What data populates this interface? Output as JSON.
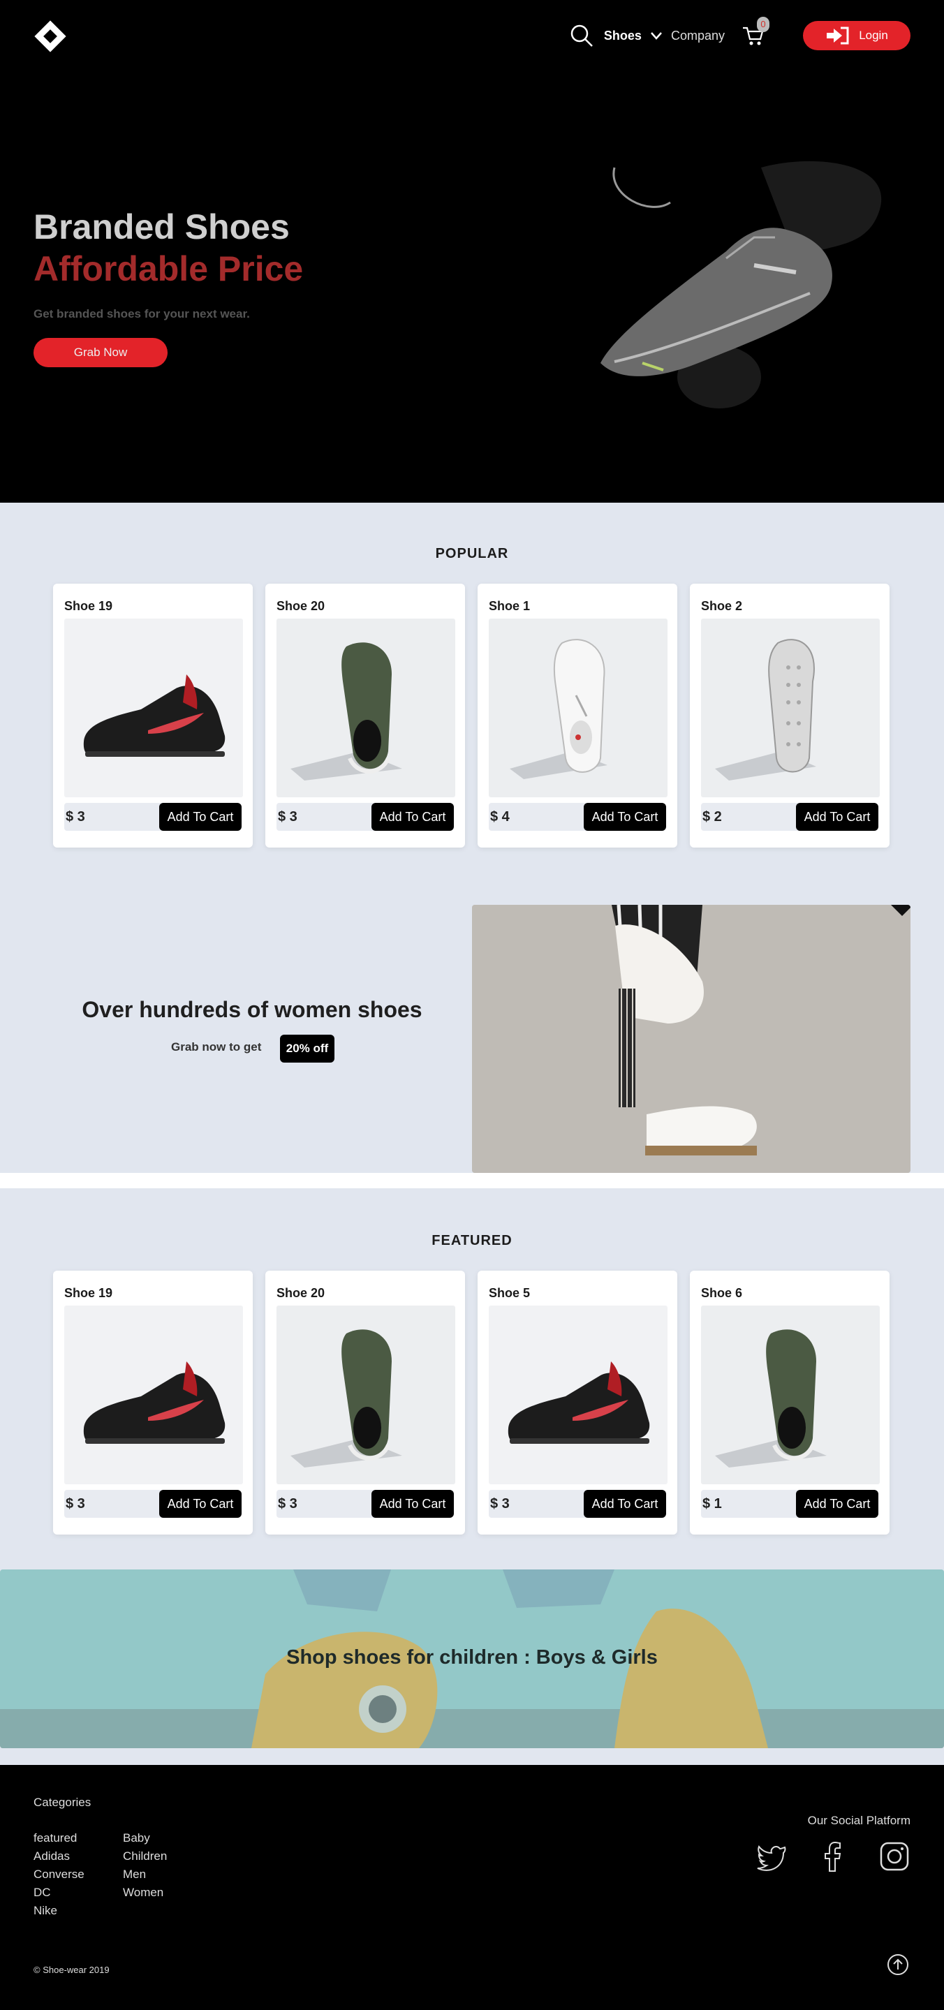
{
  "nav": {
    "logo_icon": "diamond-logo",
    "search_icon": "search-icon",
    "shoes_label": "Shoes",
    "company_label": "Company",
    "cart_count": "0",
    "login_label": "Login"
  },
  "hero": {
    "title_line1": "Branded Shoes",
    "title_line2": "Affordable Price",
    "subtitle": "Get branded shoes for your next wear.",
    "cta": "Grab Now"
  },
  "popular": {
    "title": "POPULAR",
    "items": [
      {
        "name": "Shoe 19",
        "price": "$ 3",
        "button": "Add To Cart"
      },
      {
        "name": "Shoe 20",
        "price": "$ 3",
        "button": "Add To Cart"
      },
      {
        "name": "Shoe 1",
        "price": "$ 4",
        "button": "Add To Cart"
      },
      {
        "name": "Shoe 2",
        "price": "$ 2",
        "button": "Add To Cart"
      }
    ]
  },
  "promo": {
    "title": "Over hundreds of women shoes",
    "subtitle": "Grab now to get",
    "badge": "20% off"
  },
  "featured": {
    "title": "FEATURED",
    "items": [
      {
        "name": "Shoe 19",
        "price": "$ 3",
        "button": "Add To Cart"
      },
      {
        "name": "Shoe 20",
        "price": "$ 3",
        "button": "Add To Cart"
      },
      {
        "name": "Shoe 5",
        "price": "$ 3",
        "button": "Add To Cart"
      },
      {
        "name": "Shoe 6",
        "price": "$ 1",
        "button": "Add To Cart"
      }
    ]
  },
  "kids": {
    "text": "Shop shoes for children : Boys & Girls"
  },
  "footer": {
    "categories_title": "Categories",
    "col1": [
      "featured",
      "Adidas",
      "Converse",
      "DC",
      "Nike"
    ],
    "col2": [
      "Baby",
      "Children",
      "Men",
      "Women"
    ],
    "social_title": "Our Social Platform",
    "copyright": "© Shoe-wear 2019"
  },
  "colors": {
    "accent": "#e32329",
    "hero_price": "#a32b2b",
    "section_bg": "#e1e6ef"
  }
}
